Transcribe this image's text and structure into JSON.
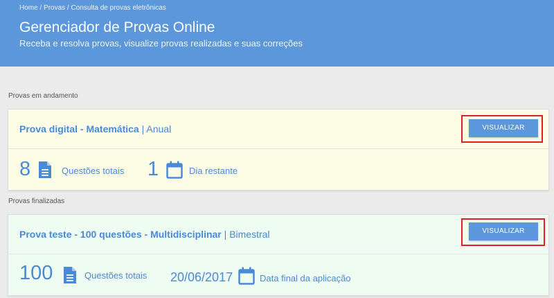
{
  "header": {
    "breadcrumb": [
      "Home",
      "Provas",
      "Consulta de provas eletrônicas"
    ],
    "breadcrumb_sep": " / ",
    "title": "Gerenciador de Provas Online",
    "subtitle": "Receba e resolva provas, visualize provas realizadas e suas correções"
  },
  "sections": {
    "in_progress_label": "Provas em andamento",
    "finished_label": "Provas finalizadas"
  },
  "cards": [
    {
      "title": "Prova digital - Matemática",
      "separator": "|",
      "period": "Anual",
      "button_label": "VISUALIZAR",
      "stat1_value": "8",
      "stat1_label": "Questões totais",
      "stat2_value": "1",
      "stat2_label": "Dia restante"
    },
    {
      "title": "Prova teste - 100 questões - Multidisciplinar",
      "separator": "|",
      "period": "Bimestral",
      "button_label": "VISUALIZAR",
      "stat1_value": "100",
      "stat1_label": "Questões totais",
      "stat2_value": "20/06/2017",
      "stat2_label": "Data final da aplicação"
    }
  ],
  "icons": {
    "document": "document-icon",
    "calendar": "calendar-icon"
  },
  "colors": {
    "header_bg": "#5b97da",
    "accent": "#4a89d6",
    "highlight": "#e1201f",
    "card_in_progress": "#fdfde6",
    "card_finished": "#effcf1"
  }
}
